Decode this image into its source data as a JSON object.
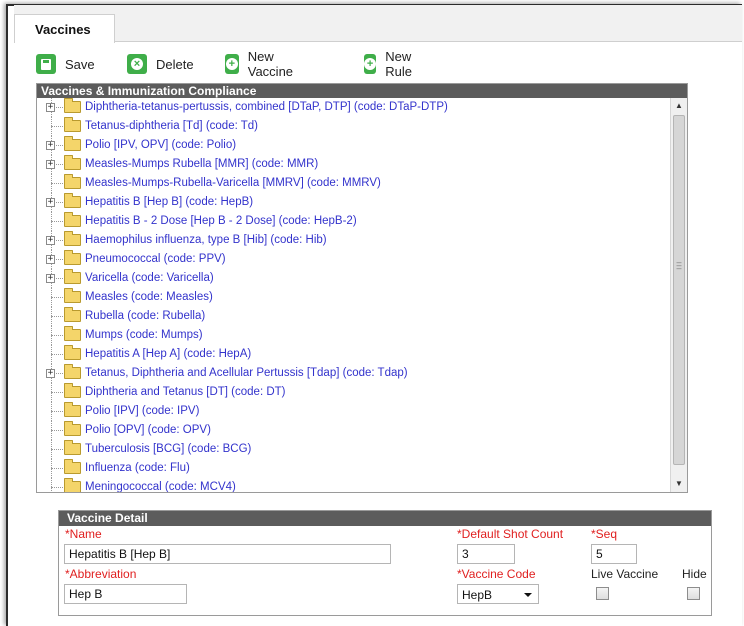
{
  "tab": {
    "label": "Vaccines"
  },
  "toolbar": {
    "save": "Save",
    "delete": "Delete",
    "new_vaccine": "New Vaccine",
    "new_rule": "New Rule"
  },
  "tree": {
    "title": "Vaccines & Immunization Compliance",
    "items": [
      {
        "label": "Diphtheria-tetanus-pertussis, combined [DTaP, DTP] (code: DTaP-DTP)",
        "expander": "+"
      },
      {
        "label": "Tetanus-diphtheria [Td] (code: Td)",
        "expander": ""
      },
      {
        "label": "Polio [IPV, OPV] (code: Polio)",
        "expander": "+"
      },
      {
        "label": "Measles-Mumps Rubella [MMR] (code: MMR)",
        "expander": "+"
      },
      {
        "label": "Measles-Mumps-Rubella-Varicella [MMRV] (code: MMRV)",
        "expander": ""
      },
      {
        "label": "Hepatitis B [Hep B] (code: HepB)",
        "expander": "+"
      },
      {
        "label": "Hepatitis B - 2 Dose [Hep B - 2 Dose] (code: HepB-2)",
        "expander": ""
      },
      {
        "label": "Haemophilus influenza, type B [Hib] (code: Hib)",
        "expander": "+"
      },
      {
        "label": "Pneumococcal (code: PPV)",
        "expander": "+"
      },
      {
        "label": "Varicella (code: Varicella)",
        "expander": "+"
      },
      {
        "label": "Measles (code: Measles)",
        "expander": ""
      },
      {
        "label": "Rubella (code: Rubella)",
        "expander": ""
      },
      {
        "label": "Mumps (code: Mumps)",
        "expander": ""
      },
      {
        "label": "Hepatitis A [Hep A] (code: HepA)",
        "expander": ""
      },
      {
        "label": "Tetanus, Diphtheria and Acellular Pertussis [Tdap] (code: Tdap)",
        "expander": "+"
      },
      {
        "label": "Diphtheria and Tetanus [DT] (code: DT)",
        "expander": ""
      },
      {
        "label": "Polio [IPV] (code: IPV)",
        "expander": ""
      },
      {
        "label": "Polio [OPV] (code: OPV)",
        "expander": ""
      },
      {
        "label": "Tuberculosis [BCG] (code: BCG)",
        "expander": ""
      },
      {
        "label": "Influenza (code: Flu)",
        "expander": ""
      },
      {
        "label": "Meningococcal (code: MCV4)",
        "expander": ""
      }
    ]
  },
  "detail": {
    "title": "Vaccine Detail",
    "name_label": "*Name",
    "name_value": "Hepatitis B [Hep B]",
    "shot_count_label": "*Default Shot Count",
    "shot_count_value": "3",
    "seq_label": "*Seq",
    "seq_value": "5",
    "abbrev_label": "*Abbreviation",
    "abbrev_value": "Hep B",
    "vaccine_code_label": "*Vaccine Code",
    "vaccine_code_value": "HepB",
    "live_vaccine_label": "Live Vaccine",
    "hide_label": "Hide"
  }
}
